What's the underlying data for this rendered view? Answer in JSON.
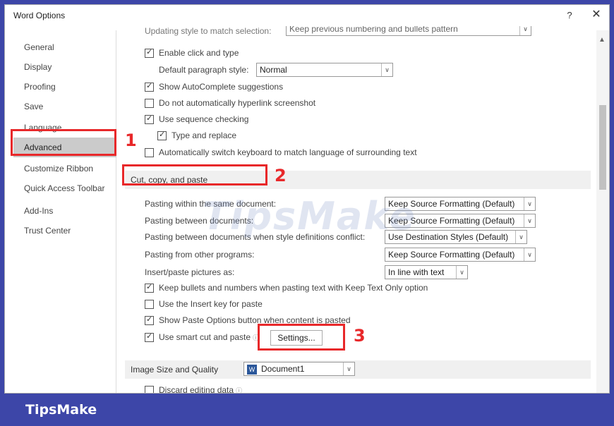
{
  "window": {
    "title": "Word Options",
    "help": "?",
    "close": "✕"
  },
  "sidebar": {
    "items": [
      {
        "label": "General"
      },
      {
        "label": "Display"
      },
      {
        "label": "Proofing"
      },
      {
        "label": "Save"
      },
      {
        "label": "Language"
      },
      {
        "label": "Advanced",
        "selected": true
      },
      {
        "label": "Customize Ribbon"
      },
      {
        "label": "Quick Access Toolbar"
      },
      {
        "label": "Add-Ins"
      },
      {
        "label": "Trust Center"
      }
    ]
  },
  "editing": {
    "partial_top_label": "Updating style to match selection:",
    "partial_top_value": "Keep previous numbering and bullets pattern",
    "enable_click_type": "Enable click and type",
    "default_para_style_label": "Default paragraph style:",
    "default_para_style_value": "Normal",
    "show_autocomplete": "Show AutoComplete suggestions",
    "no_auto_hyperlink": "Do not automatically hyperlink screenshot",
    "use_sequence": "Use sequence checking",
    "type_replace": "Type and replace",
    "auto_switch_keyboard": "Automatically switch keyboard to match language of surrounding text"
  },
  "cut_copy_paste": {
    "header": "Cut, copy, and paste",
    "within_doc_label": "Pasting within the same document:",
    "within_doc_value": "Keep Source Formatting (Default)",
    "between_docs_label": "Pasting between documents:",
    "between_docs_value": "Keep Source Formatting (Default)",
    "between_conflict_label": "Pasting between documents when style definitions conflict:",
    "between_conflict_value": "Use Destination Styles (Default)",
    "other_programs_label": "Pasting from other programs:",
    "other_programs_value": "Keep Source Formatting (Default)",
    "insert_pictures_label": "Insert/paste pictures as:",
    "insert_pictures_value": "In line with text",
    "keep_bullets": "Keep bullets and numbers when pasting text with Keep Text Only option",
    "use_insert_key": "Use the Insert key for paste",
    "show_paste_options": "Show Paste Options button when content is pasted",
    "smart_cut": "Use smart cut and paste",
    "settings_button": "Settings..."
  },
  "image_size": {
    "header": "Image Size and Quality",
    "doc_value": "Document1",
    "doc_icon": "W",
    "discard_editing": "Discard editing data"
  },
  "annotations": {
    "n1": "1",
    "n2": "2",
    "n3": "3"
  },
  "watermark": "TipsMake",
  "brand": "TipsMake",
  "icons": {
    "dropdown": "chevron-down-icon",
    "info": "info-icon",
    "check": "check-icon",
    "scroll_up": "chevron-up-icon"
  },
  "colors": {
    "highlight": "#e8282a",
    "footer": "#3d46a8",
    "selected_nav": "#cbcbcb"
  }
}
